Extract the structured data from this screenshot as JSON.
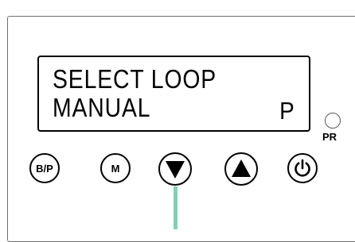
{
  "display": {
    "line1": "SELECT LOOP",
    "line2": "MANUAL",
    "program_indicator": "P"
  },
  "led": {
    "label": "PR"
  },
  "buttons": {
    "bp_label": "B/P",
    "m_label": "M",
    "down_icon": "triangle-down-icon",
    "up_icon": "triangle-up-icon",
    "power_icon": "power-icon"
  },
  "colors": {
    "indicator": "#7fd1b3",
    "panel_border": "#6e6e6e"
  }
}
